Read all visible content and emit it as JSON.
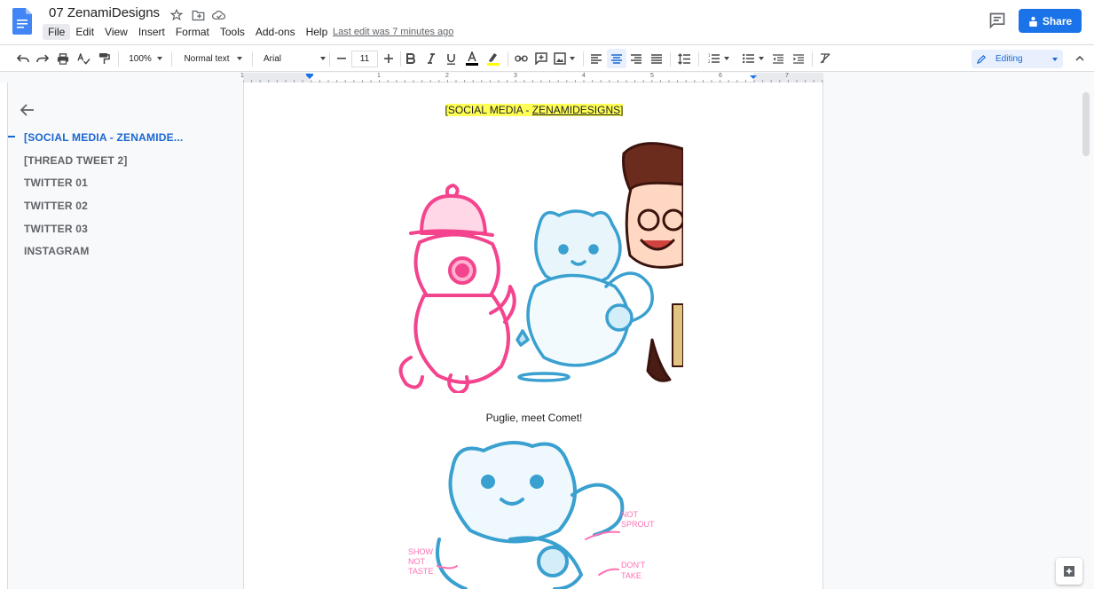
{
  "app": {
    "doc_title": "07 ZenamiDesigns",
    "last_edit": "Last edit was 7 minutes ago",
    "share_label": "Share",
    "colors": {
      "accent": "#1a73e8",
      "highlight": "#ffff55",
      "outline_active": "#1967d2"
    }
  },
  "menu": [
    "File",
    "Edit",
    "View",
    "Insert",
    "Format",
    "Tools",
    "Add-ons",
    "Help"
  ],
  "toolbar": {
    "zoom": "100%",
    "style": "Normal text",
    "font": "Arial",
    "font_size": "11",
    "mode": "Editing"
  },
  "ruler": {
    "numbers": [
      "1",
      "1",
      "2",
      "3",
      "4",
      "5",
      "6",
      "7"
    ]
  },
  "outline": {
    "items": [
      "[SOCIAL MEDIA - ZENAMIDE...",
      "[THREAD TWEET 2]",
      "TWITTER 01",
      "TWITTER 02",
      "TWITTER 03",
      "INSTAGRAM"
    ]
  },
  "document": {
    "heading_pre": "[SOCIAL MEDIA - ",
    "heading_link": "ZENAMIDESIGNS",
    "heading_post": "]",
    "caption": "Puglie, meet Comet!",
    "sketch_notes": [
      "NOT",
      "SPROUT",
      "SHOW",
      "NOT",
      "TASTE",
      "DON'T",
      "TAKE"
    ]
  }
}
